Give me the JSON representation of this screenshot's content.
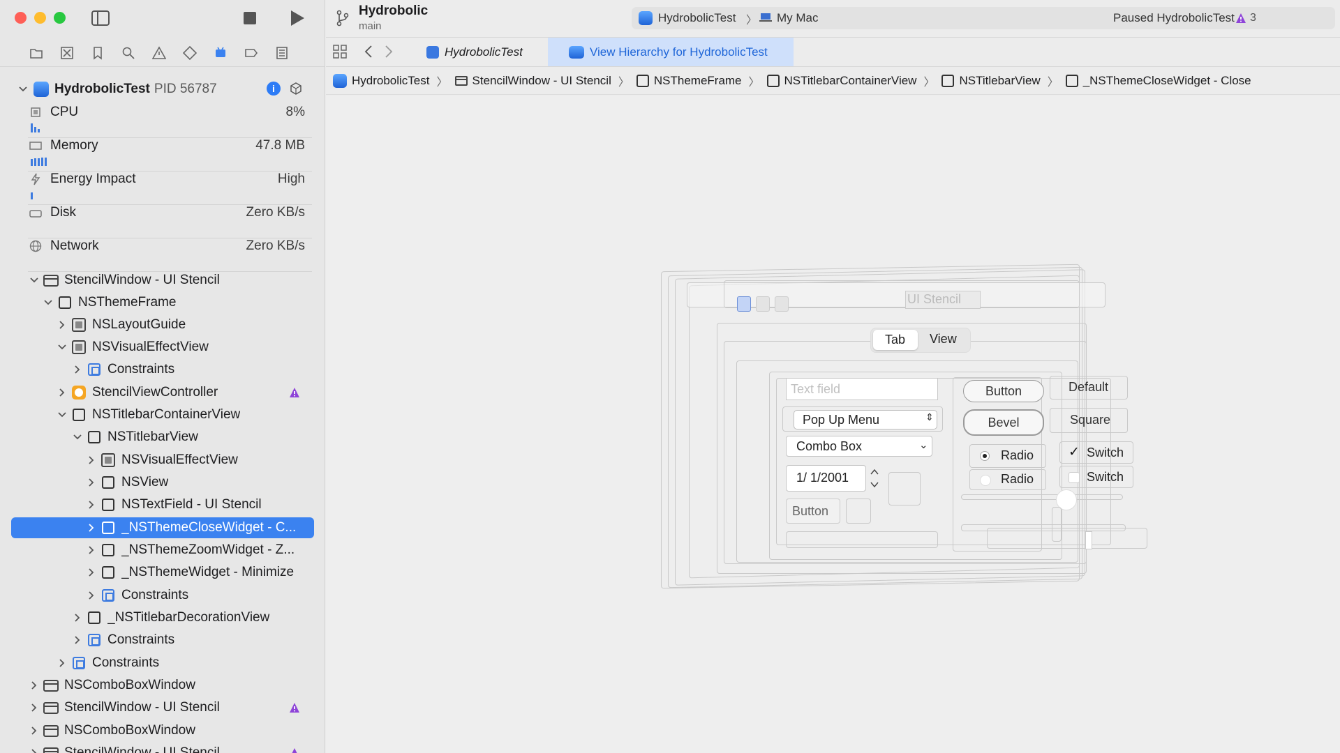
{
  "scheme": {
    "project": "Hydrobolic",
    "branch": "main",
    "target": "HydrobolicTest",
    "destination": "My Mac",
    "status": "Paused HydrobolicTest",
    "warning_count": "3"
  },
  "tabs": [
    {
      "label": "HydrobolicTest"
    },
    {
      "label": "View Hierarchy for HydrobolicTest"
    }
  ],
  "breadcrumb": [
    "HydrobolicTest",
    "StencilWindow - UI Stencil",
    "NSThemeFrame",
    "NSTitlebarContainerView",
    "NSTitlebarView",
    "_NSThemeCloseWidget - Close"
  ],
  "process": {
    "name": "HydrobolicTest",
    "pid": "PID 56787"
  },
  "gauges": [
    {
      "label": "CPU",
      "value": "8%"
    },
    {
      "label": "Memory",
      "value": "47.8 MB"
    },
    {
      "label": "Energy Impact",
      "value": "High"
    },
    {
      "label": "Disk",
      "value": "Zero KB/s"
    },
    {
      "label": "Network",
      "value": "Zero KB/s"
    }
  ],
  "tree": [
    {
      "label": "StencilWindow - UI Stencil"
    },
    {
      "label": "NSThemeFrame"
    },
    {
      "label": "NSLayoutGuide"
    },
    {
      "label": "NSVisualEffectView"
    },
    {
      "label": "Constraints"
    },
    {
      "label": "StencilViewController"
    },
    {
      "label": "NSTitlebarContainerView"
    },
    {
      "label": "NSTitlebarView"
    },
    {
      "label": "NSVisualEffectView"
    },
    {
      "label": "NSView"
    },
    {
      "label": "NSTextField - UI Stencil"
    },
    {
      "label": "_NSThemeCloseWidget - C..."
    },
    {
      "label": "_NSThemeZoomWidget - Z..."
    },
    {
      "label": "_NSThemeWidget - Minimize"
    },
    {
      "label": "Constraints"
    },
    {
      "label": "_NSTitlebarDecorationView"
    },
    {
      "label": "Constraints"
    },
    {
      "label": "Constraints"
    },
    {
      "label": "NSComboBoxWindow"
    },
    {
      "label": "StencilWindow - UI Stencil"
    },
    {
      "label": "NSComboBoxWindow"
    },
    {
      "label": "StencilWindow - UI Stencil"
    }
  ],
  "stencil": {
    "title": "UI Stencil",
    "tab": "Tab",
    "view": "View",
    "text_field_placeholder": "Text field",
    "popup": "Pop Up Menu",
    "combo": "Combo Box",
    "date": "1/  1/2001",
    "button": "Button",
    "button2": "Button",
    "default": "Default",
    "bevel": "Bevel",
    "square": "Square",
    "radio1": "Radio",
    "radio2": "Radio",
    "switch1": "Switch",
    "switch2": "Switch"
  },
  "colors": {
    "accent": "#3b82f0",
    "warning": "#8e44d8"
  }
}
